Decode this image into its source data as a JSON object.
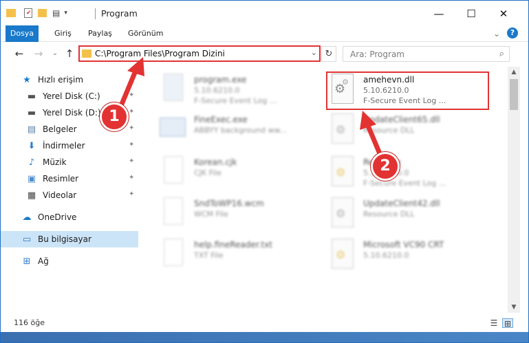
{
  "window": {
    "title": "Program",
    "controls": {
      "minimize": "—",
      "maximize": "☐",
      "close": "✕"
    }
  },
  "ribbon": {
    "tabs": [
      {
        "label": "Dosya"
      },
      {
        "label": "Giriş"
      },
      {
        "label": "Paylaş"
      },
      {
        "label": "Görünüm"
      }
    ],
    "help": "?",
    "collapse": "⌄"
  },
  "navigation": {
    "back": "←",
    "forward": "→",
    "recent": "⌄",
    "up": "↑",
    "address": "C:\\Program Files\\Program Dizini",
    "address_dropdown": "⌄",
    "refresh": "↻",
    "search_placeholder": "Ara: Program",
    "search_icon": "⌕"
  },
  "sidebar": {
    "items": [
      {
        "label": "Hızlı erişim",
        "icon": "star-icon",
        "glyph": "★",
        "color": "#1979ca"
      },
      {
        "label": "Yerel Disk (C:)",
        "icon": "drive-icon",
        "glyph": "▬",
        "color": "#555555",
        "pinned": true
      },
      {
        "label": "Yerel Disk (D:)",
        "icon": "drive-icon",
        "glyph": "▬",
        "color": "#555555",
        "pinned": true
      },
      {
        "label": "Belgeler",
        "icon": "documents-icon",
        "glyph": "▤",
        "color": "#5a7fa8",
        "pinned": true
      },
      {
        "label": "İndirmeler",
        "icon": "download-icon",
        "glyph": "⬇",
        "color": "#2d7cd0",
        "pinned": true
      },
      {
        "label": "Müzik",
        "icon": "music-icon",
        "glyph": "♪",
        "color": "#2d7cd0",
        "pinned": true
      },
      {
        "label": "Resimler",
        "icon": "pictures-icon",
        "glyph": "▣",
        "color": "#4c8ecf",
        "pinned": true
      },
      {
        "label": "Videolar",
        "icon": "videos-icon",
        "glyph": "▦",
        "color": "#444444",
        "pinned": true
      },
      {
        "label": "OneDrive",
        "icon": "cloud-icon",
        "glyph": "☁",
        "color": "#1979ca"
      },
      {
        "label": "Bu bilgisayar",
        "icon": "computer-icon",
        "glyph": "▭",
        "color": "#2d7cd0",
        "selected": true
      },
      {
        "label": "Ağ",
        "icon": "network-icon",
        "glyph": "⊞",
        "color": "#2d7cd0"
      }
    ],
    "pin_glyph": "📌"
  },
  "files": {
    "left": [
      {
        "name": "program.exe",
        "line2": "5.10.6210.0",
        "line3": "F-Secure Event Log ...",
        "icon": "exe-icon"
      },
      {
        "name": "FineExec.exe",
        "line2": "ABBYY background ww...",
        "line3": "",
        "icon": "app-window-icon"
      },
      {
        "name": "Korean.cjk",
        "line2": "CJK File",
        "line3": "",
        "icon": "file-icon"
      },
      {
        "name": "SndToWP16.wcm",
        "line2": "WCM File",
        "line3": "",
        "icon": "file-icon"
      },
      {
        "name": "help.fineReader.txt",
        "line2": "TXT File",
        "line3": "",
        "icon": "text-file-icon"
      }
    ],
    "right": [
      {
        "name": "amehevn.dll",
        "line2": "5.10.6210.0",
        "line3": "F-Secure Event Log ...",
        "icon": "dll-gear-icon",
        "highlighted": true
      },
      {
        "name": "UpdateClient65.dll",
        "line2": "Resource DLL",
        "line3": "",
        "icon": "dll-gear-icon"
      },
      {
        "name": "Resource",
        "line2": "5.10.6210.0",
        "line3": "F-Secure Event Log ...",
        "icon": "dll-gear-icon"
      },
      {
        "name": "UpdateClient42.dll",
        "line2": "Resource DLL",
        "line3": "",
        "icon": "dll-gear-icon"
      },
      {
        "name": "Microsoft VC90 CRT",
        "line2": "5.10.6210.0",
        "line3": "",
        "icon": "dll-gear-icon"
      }
    ]
  },
  "annotations": {
    "step1": "1",
    "step2": "2",
    "color": "#e23232"
  },
  "status": {
    "item_count": "116 öğe",
    "details_view_icon": "☰",
    "large_icons_view_icon": "⊞"
  },
  "scrollbar": {
    "up": "▲",
    "down": "▼"
  }
}
